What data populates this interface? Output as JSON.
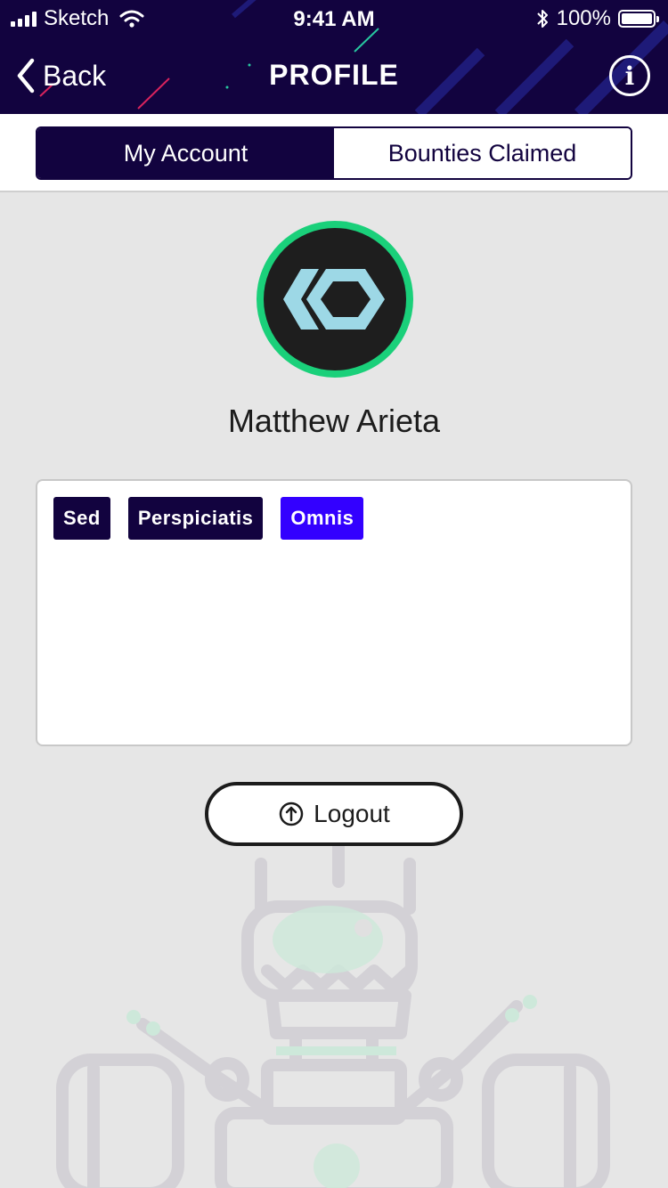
{
  "status_bar": {
    "carrier": "Sketch",
    "time": "9:41 AM",
    "battery": "100%",
    "battery_level": 1.0
  },
  "nav": {
    "back_label": "Back",
    "title": "PROFILE",
    "info_glyph": "i",
    "icons": [
      "chevron-left-icon",
      "info-icon"
    ]
  },
  "tabs": [
    {
      "label": "My Account",
      "active": true
    },
    {
      "label": "Bounties Claimed",
      "active": false
    }
  ],
  "profile": {
    "name": "Matthew Arieta",
    "avatar_icon": "hexagon-logo-icon"
  },
  "tags": [
    {
      "label": "Sed",
      "color": "#12033f"
    },
    {
      "label": "Perspiciatis",
      "color": "#12033f"
    },
    {
      "label": "Omnis",
      "color": "#3300ff"
    }
  ],
  "logout": {
    "label": "Logout",
    "icon": "power-icon"
  },
  "colors": {
    "header_bg": "#12033f",
    "accent_green": "#1ad07a",
    "tag_highlight": "#3300ff",
    "page_bg": "#e6e6e6"
  }
}
